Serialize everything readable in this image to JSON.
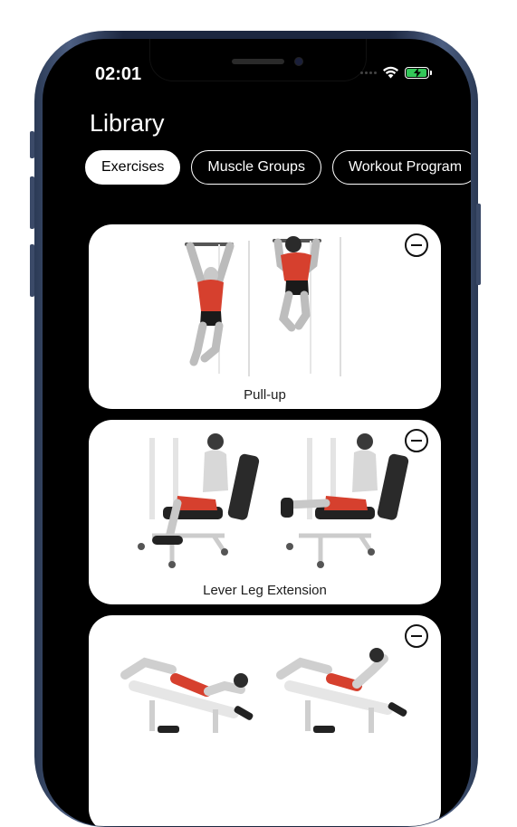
{
  "status_bar": {
    "time": "02:01",
    "battery_level": 0.95,
    "battery_color": "#34c759"
  },
  "header": {
    "title": "Library"
  },
  "tabs": [
    {
      "label": "Exercises",
      "active": true
    },
    {
      "label": "Muscle Groups",
      "active": false
    },
    {
      "label": "Workout Program",
      "active": false
    }
  ],
  "exercises": [
    {
      "name": "Pull-up",
      "icon": "minus-circle-icon"
    },
    {
      "name": "Lever Leg Extension",
      "icon": "minus-circle-icon"
    },
    {
      "name": "",
      "icon": "minus-circle-icon"
    }
  ],
  "colors": {
    "accent_muscle": "#d6402e",
    "background": "#000000",
    "card": "#ffffff"
  }
}
